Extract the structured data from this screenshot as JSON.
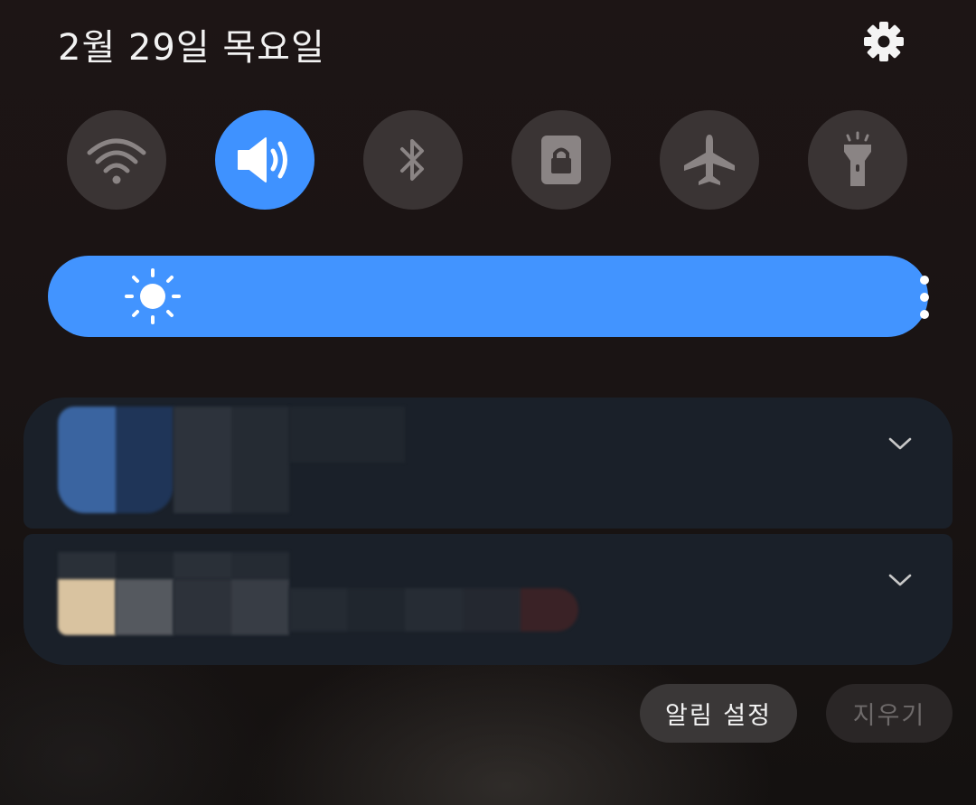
{
  "header": {
    "date": "2월 29일 목요일",
    "settings_icon": "gear-icon"
  },
  "quick_tiles": [
    {
      "name": "wifi",
      "icon": "wifi-icon",
      "active": false
    },
    {
      "name": "sound",
      "icon": "speaker-icon",
      "active": true
    },
    {
      "name": "bluetooth",
      "icon": "bluetooth-icon",
      "active": false
    },
    {
      "name": "rotation-lock",
      "icon": "lock-icon",
      "active": false
    },
    {
      "name": "airplane",
      "icon": "airplane-icon",
      "active": false
    },
    {
      "name": "flashlight",
      "icon": "flashlight-icon",
      "active": false
    }
  ],
  "brightness": {
    "icon": "sun-icon",
    "menu_icon": "more-vertical-icon",
    "level": 1.0
  },
  "notifications": [
    {
      "icon": "chevron-down-icon"
    },
    {
      "icon": "chevron-down-icon"
    }
  ],
  "actions": {
    "notification_settings_label": "알림 설정",
    "clear_label": "지우기"
  },
  "colors": {
    "accent": "#4294ff",
    "tile_inactive": "#3a3434",
    "card_background": "#1a2029"
  }
}
